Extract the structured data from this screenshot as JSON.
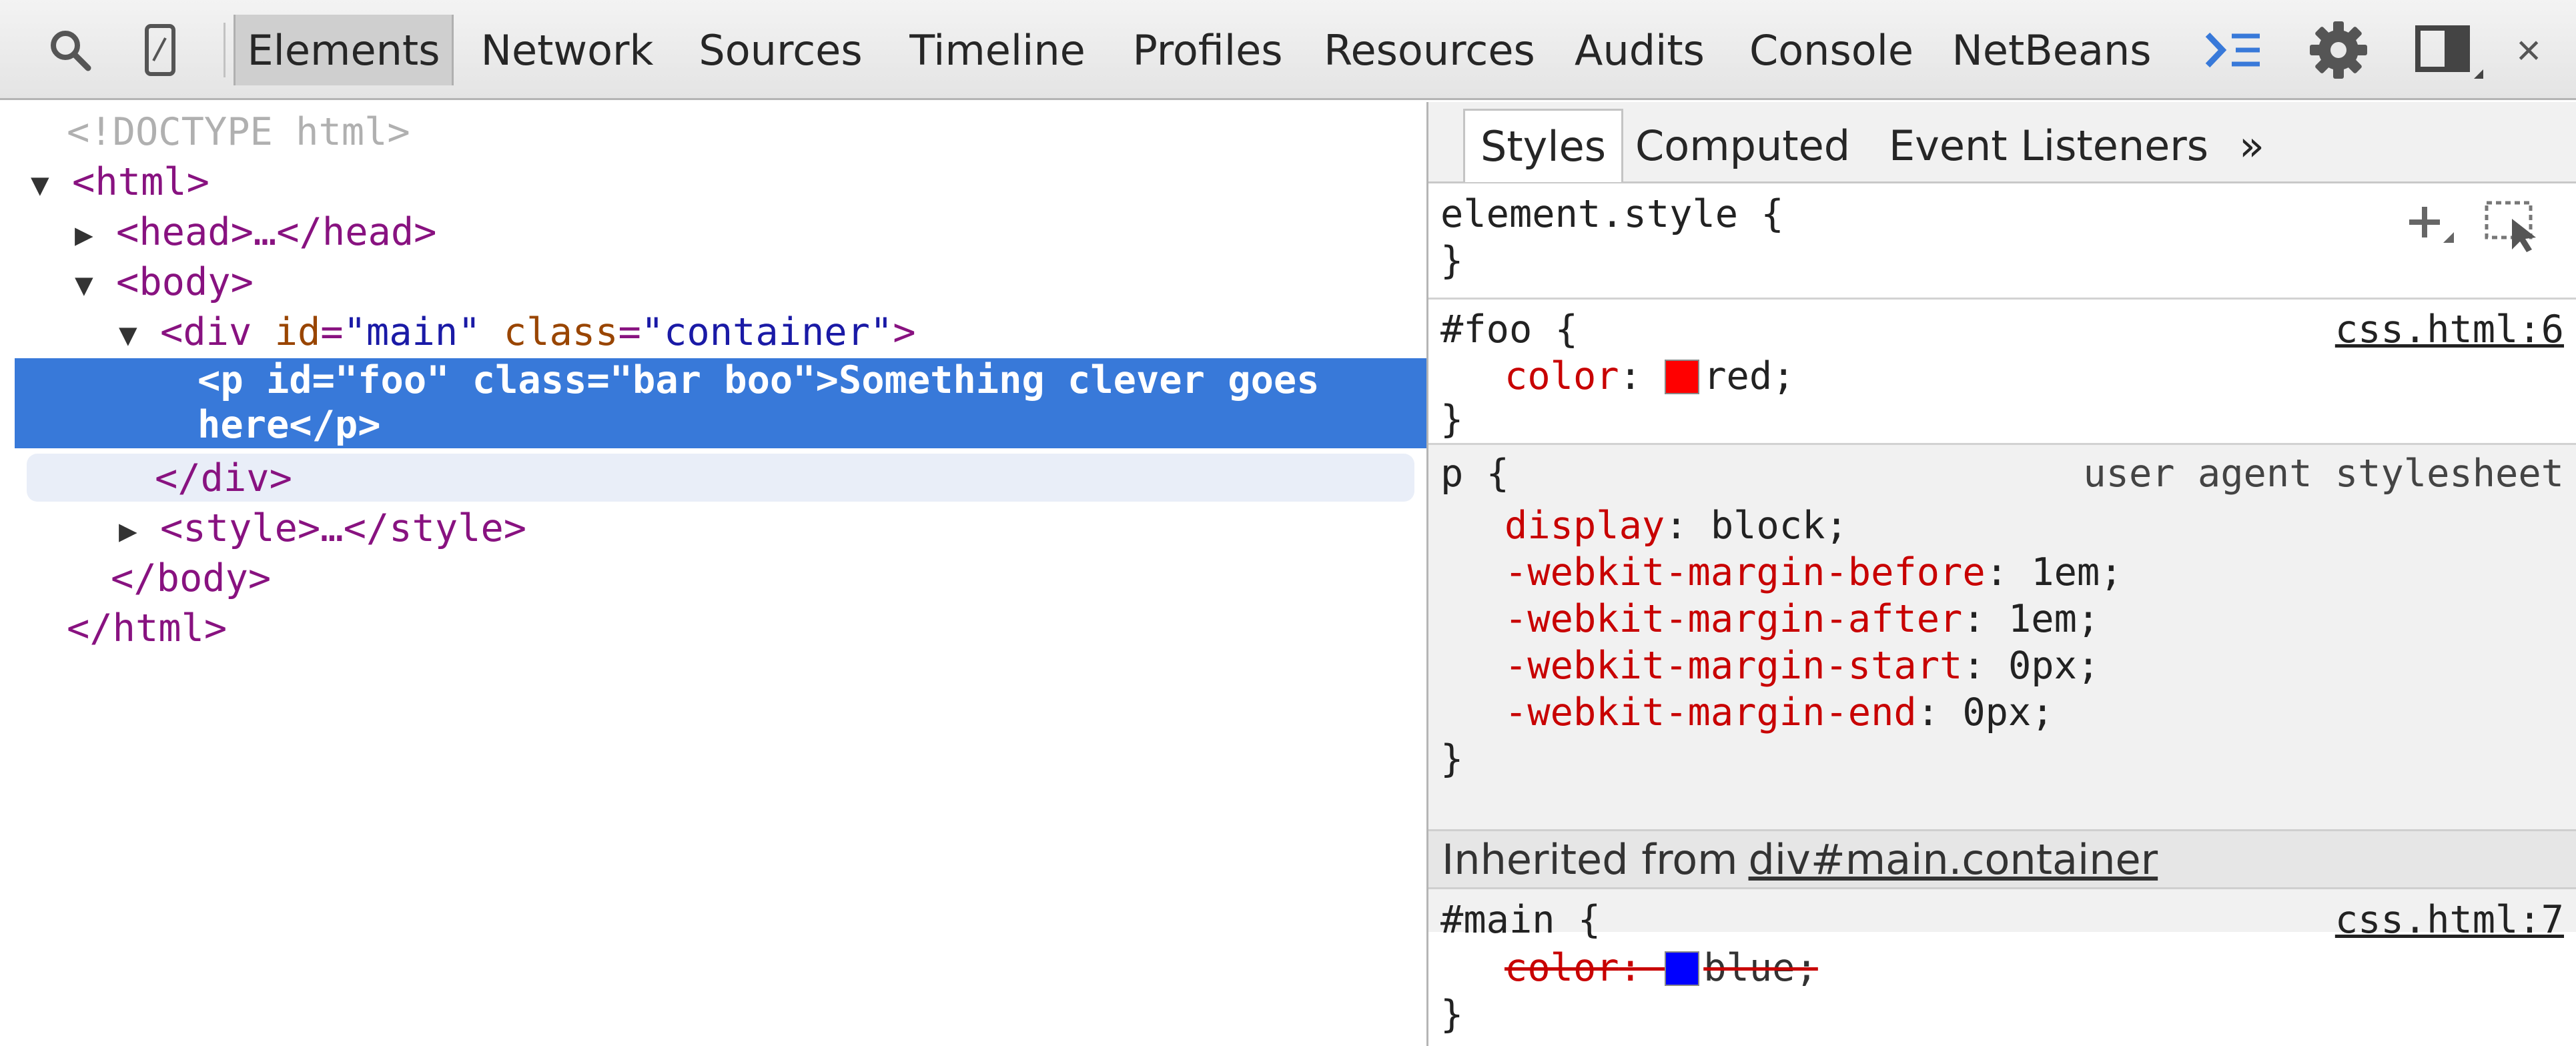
{
  "toolbar": {
    "tabs": [
      "Elements",
      "Network",
      "Sources",
      "Timeline",
      "Profiles",
      "Resources",
      "Audits",
      "Console",
      "NetBeans"
    ],
    "active_tab": "Elements",
    "icons": [
      "search-icon",
      "device-mode-icon",
      "console-drawer-icon",
      "settings-gear-icon",
      "dock-side-icon",
      "close-icon"
    ],
    "close_glyph": "×",
    "accent_color": "#3879d9"
  },
  "dom_tree": {
    "doctype": "<!DOCTYPE html>",
    "html_open": "<html>",
    "head_collapsed": "<head>…</head>",
    "body_open": "<body>",
    "div_tag_open": "<div",
    "div_id_attr": "id",
    "div_id_value": "\"main\"",
    "div_class_attr": "class",
    "div_class_value": "\"container\"",
    "div_tag_close_bracket": ">",
    "selected_line1": "<p id=\"foo\" class=\"bar boo\">Something clever goes",
    "selected_line2": "here</p>",
    "div_close": "</div>",
    "style_collapsed": "<style>…</style>",
    "body_close": "</body>",
    "html_close": "</html>",
    "expand_triangle": "▼",
    "collapse_triangle": "▶"
  },
  "sidebar": {
    "tabs": [
      "Styles",
      "Computed",
      "Event Listeners"
    ],
    "more_glyph": "»",
    "active_tab": "Styles",
    "element_style": {
      "selector": "element.style {",
      "close": "}"
    },
    "rules": [
      {
        "selector": "#foo {",
        "source": "css.html:6",
        "props": [
          {
            "name": "color",
            "value": "red;",
            "swatch": "#ff0000"
          }
        ],
        "close": "}"
      },
      {
        "selector": "p {",
        "origin": "user agent stylesheet",
        "props": [
          {
            "name": "display",
            "value": "block;"
          },
          {
            "name": "-webkit-margin-before",
            "value": "1em;"
          },
          {
            "name": "-webkit-margin-after",
            "value": "1em;"
          },
          {
            "name": "-webkit-margin-start",
            "value": "0px;"
          },
          {
            "name": "-webkit-margin-end",
            "value": "0px;"
          }
        ],
        "close": "}"
      }
    ],
    "inherited": {
      "label": "Inherited from",
      "link": "div#main.container"
    },
    "inherited_rule": {
      "selector": "#main {",
      "source": "css.html:7",
      "prop_name": "color",
      "prop_value": "blue;",
      "swatch": "#0000ff",
      "overridden": true,
      "close": "}"
    }
  }
}
